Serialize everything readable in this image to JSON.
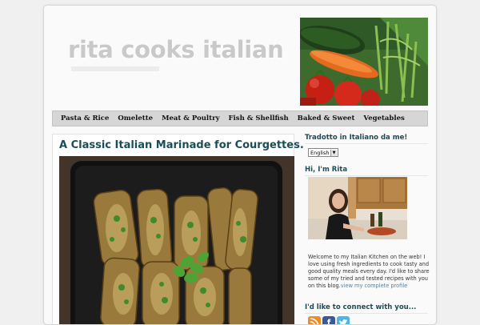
{
  "site": {
    "title": "rita cooks italian"
  },
  "nav": {
    "items": [
      {
        "label": "Pasta & Rice"
      },
      {
        "label": "Omelette"
      },
      {
        "label": "Meat & Poultry"
      },
      {
        "label": "Fish & Shellfish"
      },
      {
        "label": "Baked & Sweet"
      },
      {
        "label": "Vegetables"
      }
    ]
  },
  "post": {
    "title": "A Classic Italian Marinade for Courgettes."
  },
  "sidebar": {
    "translate_title": "Tradotto in Italiano da me!",
    "language_selected": "English",
    "about_title": "Hi, I'm Rita",
    "about_text": "Welcome to my Italian Kitchen on the web! I love using fresh ingredients to cook tasty and good quality meals every day. I'd like to share some of my tried and tested recipes with you on this blog.",
    "about_more": "view my complete profile",
    "connect_title": "I'd like to connect with you..."
  },
  "colors": {
    "title_accent": "#1b4d57",
    "nav_bg": "#d6d6d6",
    "rss": "#f08a24",
    "facebook": "#3b5998",
    "twitter": "#4cb4e7"
  },
  "icons": [
    "rss-icon",
    "facebook-icon",
    "twitter-icon"
  ]
}
